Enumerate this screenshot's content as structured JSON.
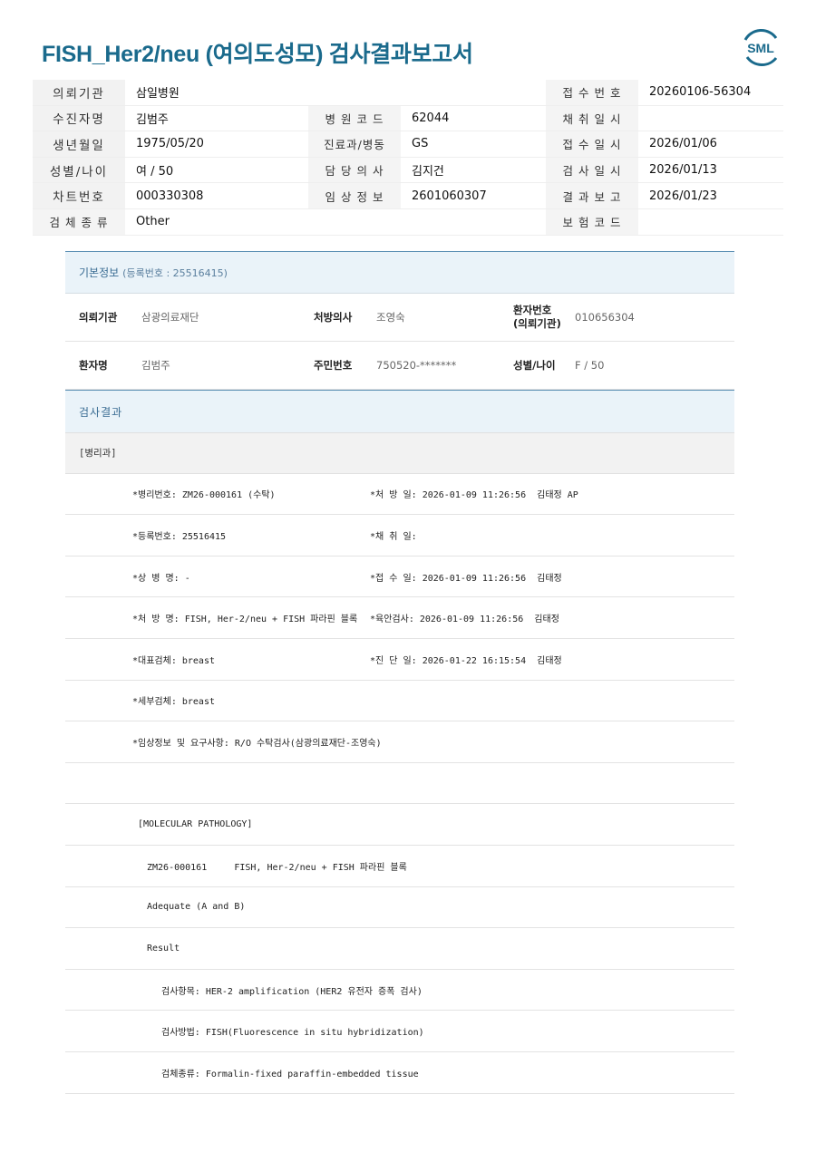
{
  "header": {
    "title": "FISH_Her2/neu (여의도성모) 검사결과보고서",
    "logo_text": "SML"
  },
  "info": [
    {
      "l1": "의뢰기관",
      "v1": "삼일병원",
      "l3": "접 수 번 호",
      "v3": "20260106-56304"
    },
    {
      "l1": "수진자명",
      "v1": "김범주",
      "l2": "병 원 코 드",
      "v2": "62044",
      "l3": "채 취 일 시",
      "v3": ""
    },
    {
      "l1": "생년월일",
      "v1": "1975/05/20",
      "l2": "진료과/병동",
      "v2": "GS",
      "l3": "접 수 일 시",
      "v3": "2026/01/06"
    },
    {
      "l1": "성별/나이",
      "v1": "여 / 50",
      "l2": "담 당 의 사",
      "v2": "김지건",
      "l3": "검 사 일 시",
      "v3": "2026/01/13"
    },
    {
      "l1": "차트번호",
      "v1": "000330308",
      "l2": "임 상 정 보",
      "v2": "2601060307",
      "l3": "결 과 보 고",
      "v3": "2026/01/23"
    },
    {
      "l1": "검 체 종 류",
      "v1": "Other",
      "l3": "보 험 코 드",
      "v3": ""
    }
  ],
  "basic": {
    "head": "기본정보",
    "reg_label": "(등록번호 : 25516415)",
    "row1": {
      "k1": "의뢰기관",
      "v1": "삼광의료재단",
      "k2": "처방의사",
      "v2": "조영숙",
      "k3a": "환자번호",
      "k3b": "(의뢰기관)",
      "v3": "010656304"
    },
    "row2": {
      "k1": "환자명",
      "v1": "김범주",
      "k2": "주민번호",
      "v2": "750520-*******",
      "k3": "성별/나이",
      "v3": "F / 50"
    }
  },
  "result": {
    "head": "검사결과",
    "dept": "[병리과]",
    "rows": [
      {
        "l": "*병리번호: ZM26-000161 (수탁)",
        "r": "*처 방 일: 2026-01-09 11:26:56  김태정 AP"
      },
      {
        "l": "*등록번호: 25516415",
        "r": "*채 취 일:"
      },
      {
        "l": "*상 병 명: -",
        "r": "*접 수 일: 2026-01-09 11:26:56  김태정"
      },
      {
        "l": "*처 방 명: FISH, Her-2/neu + FISH 파라핀 블록",
        "r": "*육안검사: 2026-01-09 11:26:56  김태정"
      },
      {
        "l": "*대표검체: breast",
        "r": "*진 단 일: 2026-01-22 16:15:54  김태정"
      },
      {
        "l": "*세부검체: breast",
        "r": ""
      },
      {
        "l": "*임상정보 및 요구사항: R/O 수탁검사(삼광의료재단-조영숙)",
        "r": ""
      },
      {
        "l": "",
        "r": ""
      }
    ],
    "body": [
      {
        "text": "[MOLECULAR PATHOLOGY]",
        "indent": 1
      },
      {
        "text": "ZM26-000161     FISH, Her-2/neu + FISH 파라핀 블록",
        "indent": 2
      },
      {
        "text": "Adequate (A and B)",
        "indent": 2
      },
      {
        "text": "Result",
        "indent": 2
      },
      {
        "text": "검사항목: HER-2 amplification (HER2 유전자 증폭 검사)",
        "indent": 3
      },
      {
        "text": "검사방법: FISH(Fluorescence in situ hybridization)",
        "indent": 3
      },
      {
        "text": "검체종류: Formalin-fixed paraffin-embedded tissue",
        "indent": 3
      }
    ]
  }
}
